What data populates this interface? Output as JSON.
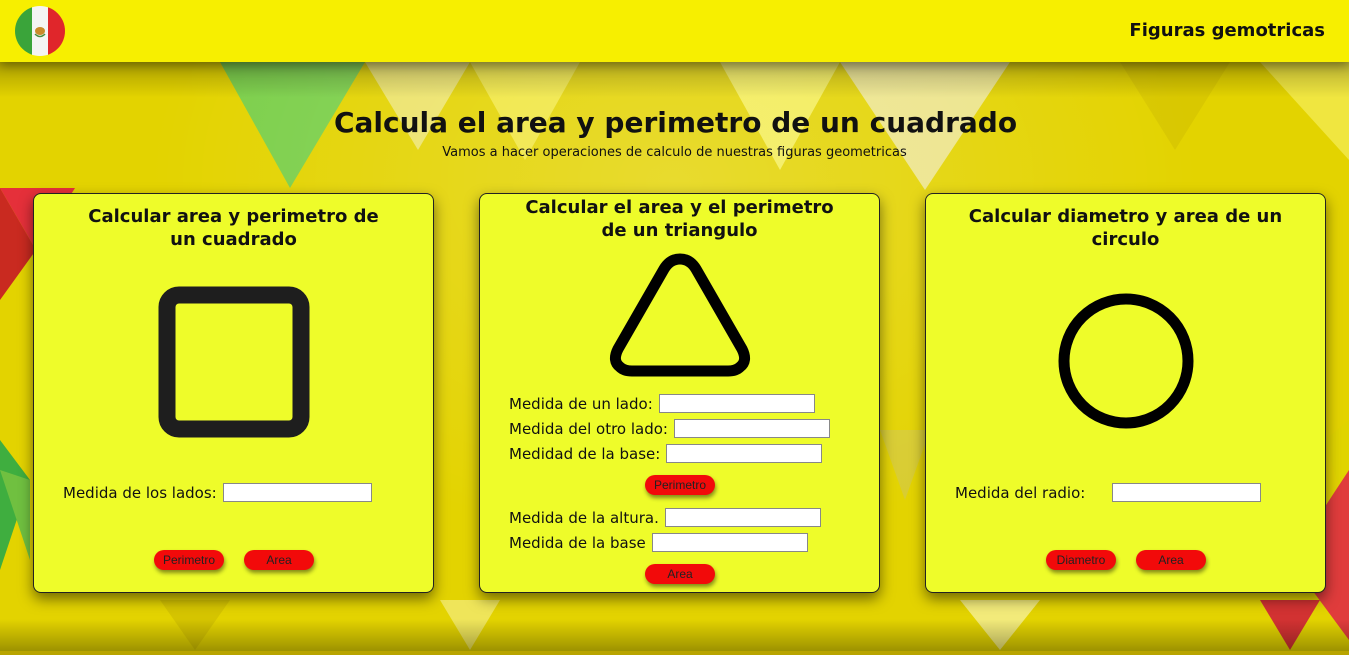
{
  "header": {
    "brand": "Figuras gemotricas",
    "logo_icon": "mexican-flag-icon"
  },
  "hero": {
    "title": "Calcula el area y perimetro de un cuadrado",
    "subtitle": "Vamos a hacer operaciones de calculo de nuestras figuras geometricas"
  },
  "colors": {
    "header_bg": "#f7ef00",
    "card_bg": "#eefc2a",
    "button_bg": "#f20a0a",
    "shape_stroke_square": "#1e1e1e",
    "shape_stroke": "#000000"
  },
  "cards": {
    "square": {
      "title": "Calcular area y perimetro de un cuadrado",
      "icon": "square-icon",
      "fields": [
        {
          "label": "Medida de los lados:",
          "value": "",
          "placeholder": ""
        }
      ],
      "buttons": {
        "perimeter": "Perimetro",
        "area": "Area"
      }
    },
    "triangle": {
      "title": "Calcular el area y el perimetro de un triangulo",
      "icon": "triangle-icon",
      "perimeter_fields": [
        {
          "label": "Medida de un lado:",
          "value": "",
          "placeholder": ""
        },
        {
          "label": "Medida del otro lado:",
          "value": "",
          "placeholder": ""
        },
        {
          "label": "Medidad de la base:",
          "value": "",
          "placeholder": ""
        }
      ],
      "area_fields": [
        {
          "label": "Medida de la altura.",
          "value": "",
          "placeholder": ""
        },
        {
          "label": "Medida de la base",
          "value": "",
          "placeholder": ""
        }
      ],
      "buttons": {
        "perimeter": "Perimetro",
        "area": "Area"
      }
    },
    "circle": {
      "title": "Calcular diametro y area de un circulo",
      "icon": "circle-icon",
      "fields": [
        {
          "label": "Medida del radio:",
          "value": "",
          "placeholder": ""
        }
      ],
      "buttons": {
        "diameter": "Diametro",
        "area": "Area"
      }
    }
  }
}
